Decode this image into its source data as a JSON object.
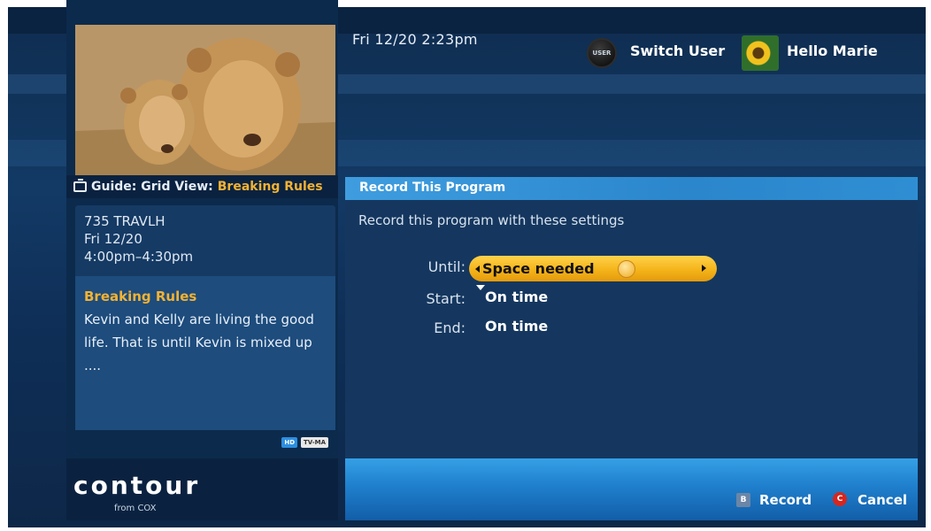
{
  "header": {
    "datetime": "Fri 12/20  2:23pm",
    "user_badge": "USER",
    "switch_user_label": "Switch User",
    "greeting": "Hello Marie",
    "avatar_icon": "sunflower-avatar"
  },
  "guide": {
    "prefix": "Guide: Grid View:",
    "title": "Breaking Rules",
    "icon": "tv-icon"
  },
  "program": {
    "channel": "735 TRAVLH",
    "date": "Fri 12/20",
    "time": "4:00pm–4:30pm",
    "title": "Breaking Rules",
    "description": "Kevin and Kelly are living the good life. That is until Kevin is mixed up ....",
    "badges": [
      "HD",
      "TV-MA"
    ]
  },
  "record": {
    "header": "Record This Program",
    "instruction": "Record this program with these settings",
    "until_label": "Until:",
    "until_value": "Space needed",
    "start_label": "Start:",
    "start_value": "On time",
    "end_label": "End:",
    "end_value": "On time"
  },
  "footer": {
    "logo": "contour",
    "logo_sub": "from COX",
    "record_key": "B",
    "record_label": "Record",
    "cancel_key": "C",
    "cancel_label": "Cancel"
  },
  "colors": {
    "accent_gold": "#f3b233",
    "header_blue": "#2b86cc",
    "cancel_red": "#d6261f"
  }
}
